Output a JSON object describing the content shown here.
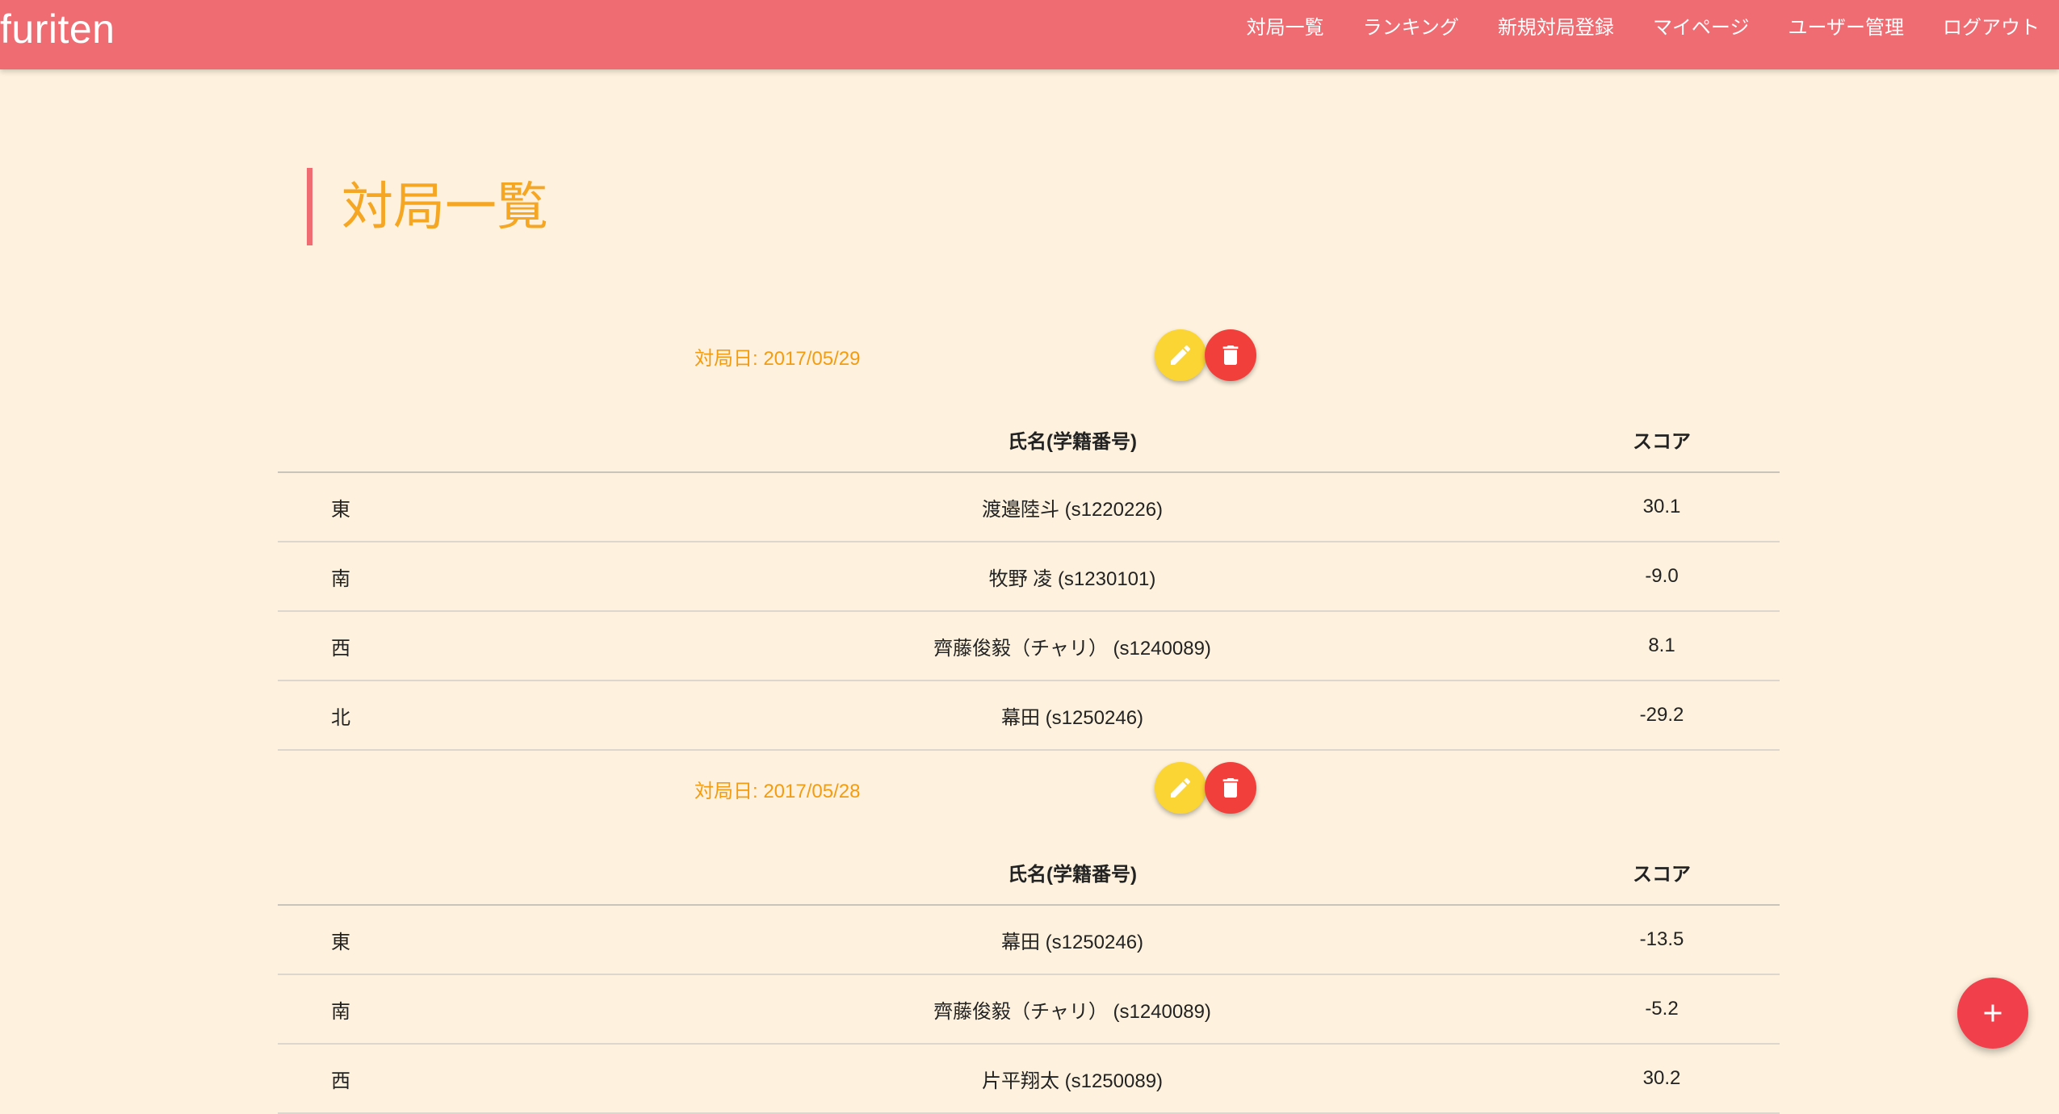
{
  "app": {
    "brand": "furiten"
  },
  "nav": {
    "items": [
      {
        "label": "対局一覧"
      },
      {
        "label": "ランキング"
      },
      {
        "label": "新規対局登録"
      },
      {
        "label": "マイページ"
      },
      {
        "label": "ユーザー管理"
      },
      {
        "label": "ログアウト"
      }
    ]
  },
  "page": {
    "title": "対局一覧"
  },
  "table_headers": {
    "seat": "",
    "name": "氏名(学籍番号)",
    "score": "スコア"
  },
  "matches": [
    {
      "date_label": "対局日: 2017/05/29",
      "rows": [
        {
          "seat": "東",
          "name": "渡邉陸斗 (s1220226)",
          "score": "30.1"
        },
        {
          "seat": "南",
          "name": "牧野 凌 (s1230101)",
          "score": "-9.0"
        },
        {
          "seat": "西",
          "name": "齊藤俊毅（チャリ） (s1240089)",
          "score": "8.1"
        },
        {
          "seat": "北",
          "name": "幕田 (s1250246)",
          "score": "-29.2"
        }
      ]
    },
    {
      "date_label": "対局日: 2017/05/28",
      "rows": [
        {
          "seat": "東",
          "name": "幕田 (s1250246)",
          "score": "-13.5"
        },
        {
          "seat": "南",
          "name": "齊藤俊毅（チャリ） (s1240089)",
          "score": "-5.2"
        },
        {
          "seat": "西",
          "name": "片平翔太 (s1250089)",
          "score": "30.2"
        }
      ]
    }
  ],
  "icons": {
    "edit": "pencil-icon",
    "delete": "trash-icon",
    "add": "plus-icon"
  },
  "colors": {
    "navbar": "#ef6c73",
    "background": "#fef2de",
    "title": "#f5a623",
    "date": "#f39c12",
    "edit_button": "#fbd533",
    "delete_button": "#f1403b",
    "add_button": "#f1404b"
  }
}
